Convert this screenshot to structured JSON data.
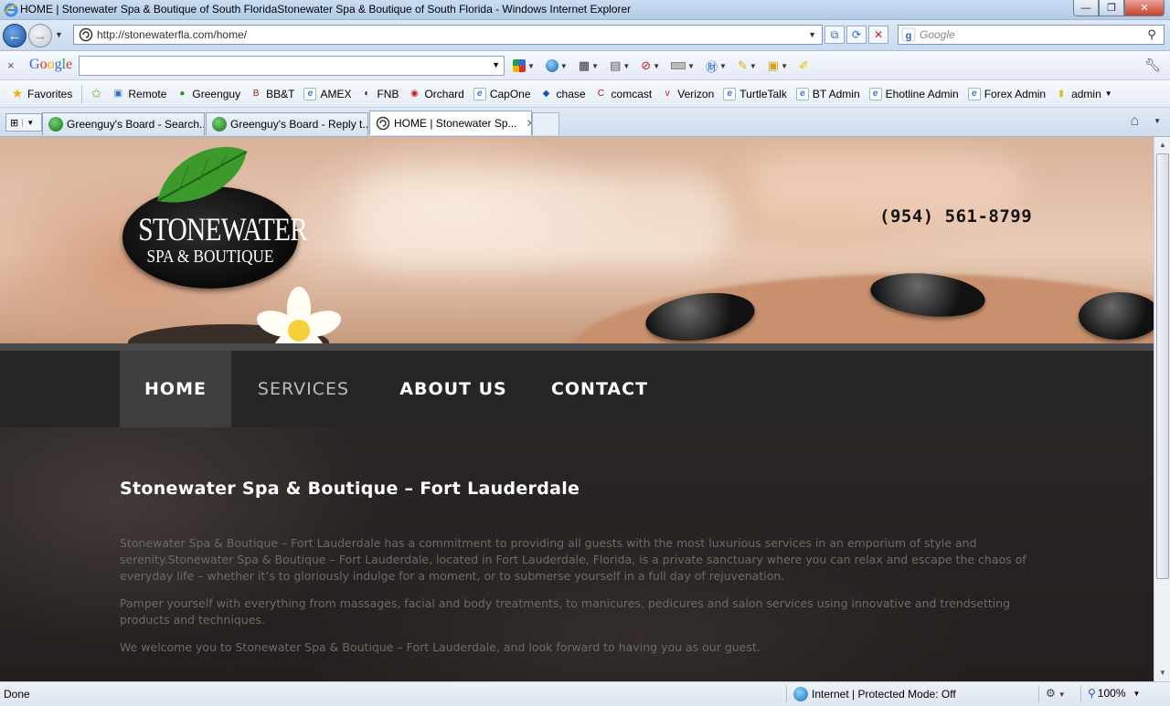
{
  "window": {
    "title": "HOME | Stonewater Spa & Boutique of South FloridaStonewater Spa & Boutique of South Florida - Windows Internet Explorer",
    "minimize": "—",
    "maximize": "❐",
    "close": "✕"
  },
  "address": {
    "url": "http://stonewaterfla.com/home/",
    "search_placeholder": "Google"
  },
  "google_toolbar": {
    "close": "×",
    "logo": "Google",
    "search_value": ""
  },
  "favorites": {
    "label": "Favorites",
    "items": [
      {
        "label": "Remote",
        "icon": "remote-icon",
        "color": "#2f6fc4"
      },
      {
        "label": "Greenguy",
        "icon": "greenguy-icon",
        "color": "#2f8a2f"
      },
      {
        "label": "BB&T",
        "icon": "bbt-icon",
        "color": "#8b1c1c"
      },
      {
        "label": "AMEX",
        "icon": "ie-page-icon",
        "color": "#3a78c9"
      },
      {
        "label": "FNB",
        "icon": "fnb-icon",
        "color": "#222222"
      },
      {
        "label": "Orchard",
        "icon": "orchard-icon",
        "color": "#c0201c"
      },
      {
        "label": "CapOne",
        "icon": "ie-page-icon",
        "color": "#3a78c9"
      },
      {
        "label": "chase",
        "icon": "chase-icon",
        "color": "#1457a8"
      },
      {
        "label": "comcast",
        "icon": "comcast-icon",
        "color": "#b01010"
      },
      {
        "label": "Verizon",
        "icon": "verizon-icon",
        "color": "#c8102e"
      },
      {
        "label": "TurtleTalk",
        "icon": "ie-page-icon",
        "color": "#3a78c9"
      },
      {
        "label": "BT Admin",
        "icon": "ie-page-icon",
        "color": "#3a78c9"
      },
      {
        "label": "Ehotline Admin",
        "icon": "ie-page-icon",
        "color": "#3a78c9"
      },
      {
        "label": "Forex Admin",
        "icon": "ie-page-icon",
        "color": "#3a78c9"
      },
      {
        "label": "admin",
        "icon": "folder-icon",
        "color": "#e6b93c"
      }
    ]
  },
  "tabs": [
    {
      "label": "Greenguy's Board - Search...",
      "active": false
    },
    {
      "label": "Greenguy's Board - Reply t...",
      "active": false
    },
    {
      "label": "HOME | Stonewater Sp...",
      "active": true
    }
  ],
  "page": {
    "phone": "(954) 561-8799",
    "logo": {
      "line1": "STONEWATER",
      "line2": "SPA & BOUTIQUE"
    },
    "nav": [
      "HOME",
      "SERVICES",
      "ABOUT US",
      "CONTACT"
    ],
    "heading": "Stonewater Spa & Boutique – Fort Lauderdale",
    "paragraphs": [
      "Stonewater Spa & Boutique – Fort Lauderdale has a commitment to providing all guests with the most luxurious services in an emporium of style and serenity.Stonewater Spa & Boutique – Fort Lauderdale, located in Fort Lauderdale, Florida, is a private sanctuary where you can relax and escape the chaos of everyday life – whether it’s to gloriously indulge for a moment, or to submerse yourself in a full day of rejuvenation.",
      "Pamper yourself with everything from massages, facial and body treatments, to manicures, pedicures and salon services using innovative and trendsetting products and techniques.",
      "We welcome you to Stonewater Spa & Boutique – Fort Lauderdale, and look forward to having you as our guest."
    ]
  },
  "status": {
    "left": "Done",
    "zone": "Internet | Protected Mode: Off",
    "zoom": "100%"
  }
}
